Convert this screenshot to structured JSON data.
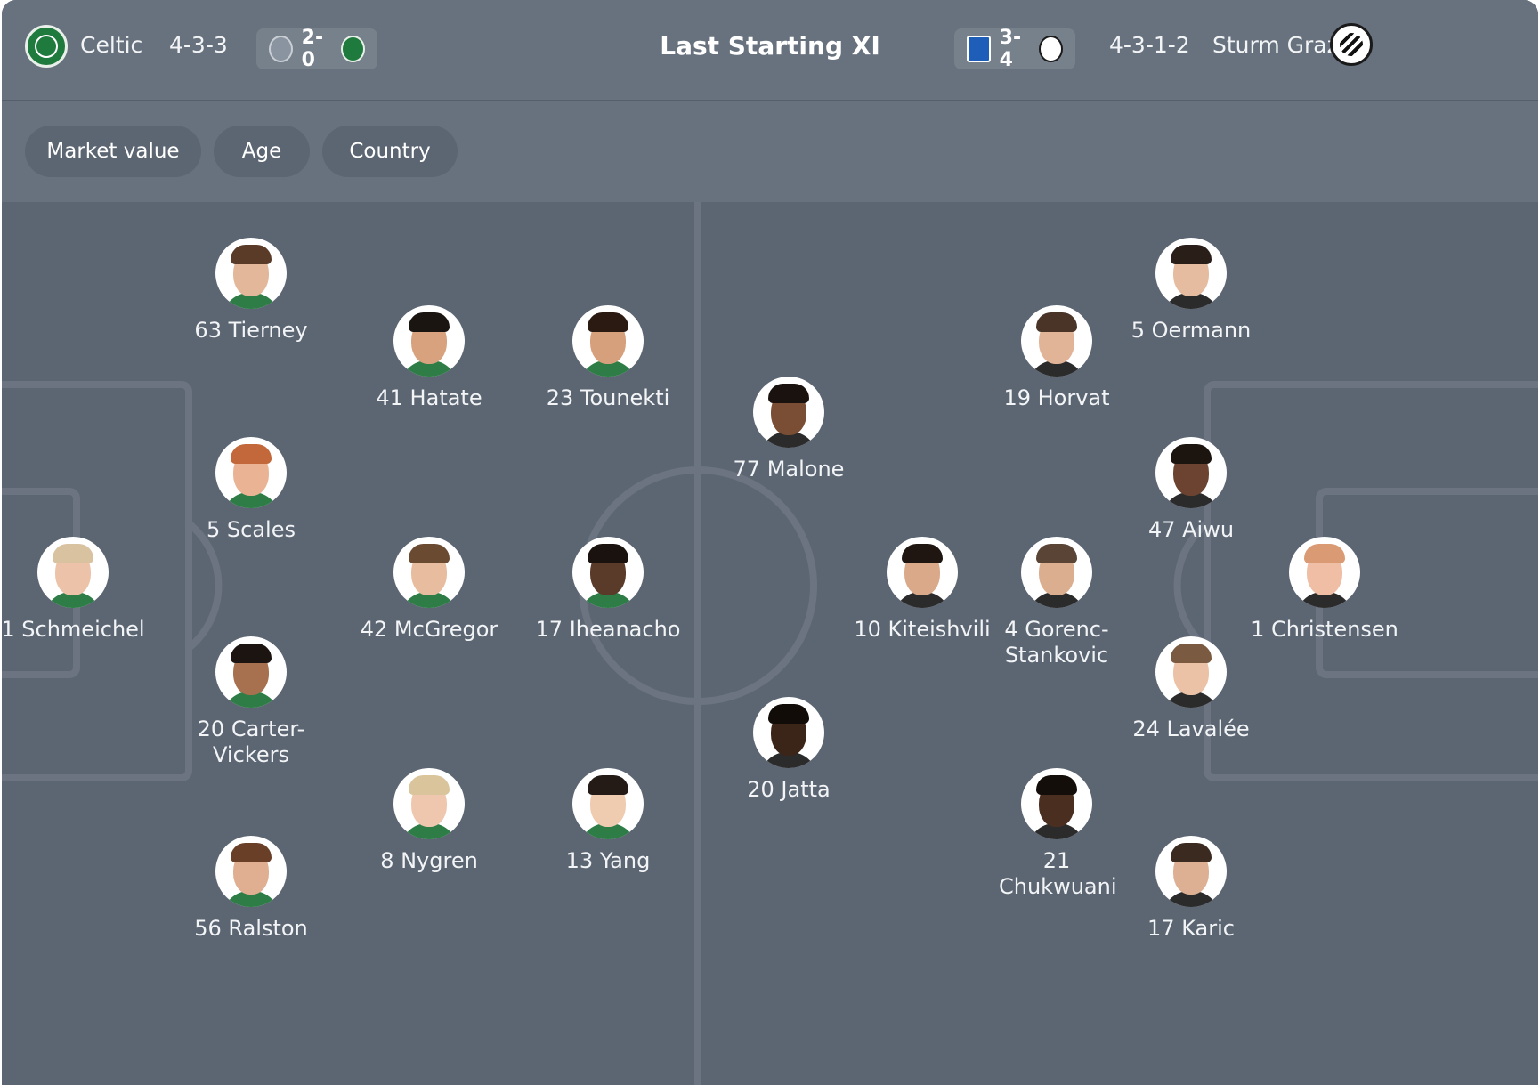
{
  "header": {
    "title": "Last Starting XI",
    "home": {
      "name": "Celtic",
      "formation": "4-3-3",
      "crest_icon": "celtic-crest-icon",
      "last_result": {
        "score": "2-0",
        "opponent_icon": "sheriff-crest-icon",
        "team_icon": "celtic-crest-icon"
      }
    },
    "away": {
      "name": "Sturm Graz",
      "formation": "4-3-1-2",
      "crest_icon": "sturm-graz-crest-icon",
      "last_result": {
        "score": "3-4",
        "opponent_icon": "blau-weiss-linz-crest-icon",
        "team_icon": "sturm-graz-crest-icon"
      }
    }
  },
  "filters": [
    "Market value",
    "Age",
    "Country"
  ],
  "colors": {
    "panel": "#5c6673",
    "header": "#68727e",
    "pitch_lines": "#6b7480",
    "text": "#f2f4f6"
  },
  "home_players": [
    {
      "label": "63 Tierney",
      "skin": "#e3b89a",
      "hair": "#5a3b28"
    },
    {
      "label": "41 Hatate",
      "skin": "#d7a27d",
      "hair": "#1b1512"
    },
    {
      "label": "23 Tounekti",
      "skin": "#d6a07c",
      "hair": "#2a1a12"
    },
    {
      "label": "5 Scales",
      "skin": "#eab394",
      "hair": "#c2683a"
    },
    {
      "label": "1 Schmeichel",
      "skin": "#ecc2a8",
      "hair": "#d8c2a0"
    },
    {
      "label": "42 McGregor",
      "skin": "#e8bc9f",
      "hair": "#6b4a32"
    },
    {
      "label": "17 Iheanacho",
      "skin": "#5a3a28",
      "hair": "#1a120e"
    },
    {
      "label": "20 Carter-Vickers",
      "skin": "#a7714f",
      "hair": "#1c1410"
    },
    {
      "label": "8 Nygren",
      "skin": "#efc7ae",
      "hair": "#d9c49c"
    },
    {
      "label": "13 Yang",
      "skin": "#efcbb0",
      "hair": "#241b16"
    },
    {
      "label": "56 Ralston",
      "skin": "#e0ae91",
      "hair": "#6a3f28"
    }
  ],
  "away_players": [
    {
      "label": "5 Oermann",
      "skin": "#e6bca0",
      "hair": "#2a1e18"
    },
    {
      "label": "19 Horvat",
      "skin": "#e2b497",
      "hair": "#4a3428"
    },
    {
      "label": "77 Malone",
      "skin": "#7a4e34",
      "hair": "#1a120e"
    },
    {
      "label": "47 Aiwu",
      "skin": "#6b4330",
      "hair": "#1c140f"
    },
    {
      "label": "10 Kiteishvili",
      "skin": "#d9a98a",
      "hair": "#1f1612"
    },
    {
      "label": "4 Gorenc-Stankovic",
      "skin": "#dcae90",
      "hair": "#5a4436"
    },
    {
      "label": "1 Christensen",
      "skin": "#efbea4",
      "hair": "#d99a74"
    },
    {
      "label": "24 Lavalée",
      "skin": "#ecc2a6",
      "hair": "#7a5a40"
    },
    {
      "label": "20 Jatta",
      "skin": "#3b2418",
      "hair": "#120c09"
    },
    {
      "label": "21 Chukwuani",
      "skin": "#4a2e20",
      "hair": "#140e0a"
    },
    {
      "label": "17 Karic",
      "skin": "#deb093",
      "hair": "#3a2a20"
    }
  ]
}
